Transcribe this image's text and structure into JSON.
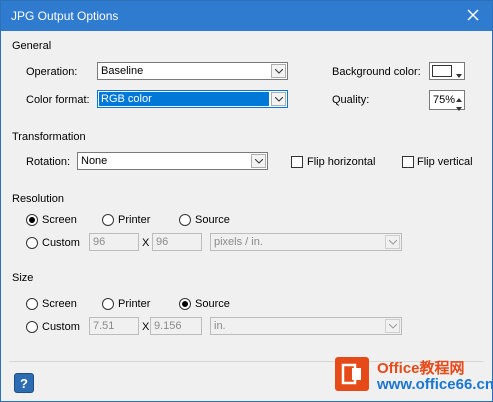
{
  "window": {
    "title": "JPG Output Options"
  },
  "general": {
    "section_label": "General",
    "operation_label": "Operation:",
    "operation_value": "Baseline",
    "color_format_label": "Color format:",
    "color_format_value": "RGB color",
    "background_color_label": "Background color:",
    "background_color_value": "#ffffff",
    "quality_label": "Quality:",
    "quality_value": "75%"
  },
  "transformation": {
    "section_label": "Transformation",
    "rotation_label": "Rotation:",
    "rotation_value": "None",
    "flip_horizontal_label": "Flip horizontal",
    "flip_vertical_label": "Flip vertical",
    "flip_horizontal_checked": false,
    "flip_vertical_checked": false
  },
  "resolution": {
    "section_label": "Resolution",
    "screen_label": "Screen",
    "printer_label": "Printer",
    "source_label": "Source",
    "custom_label": "Custom",
    "selected": "Screen",
    "custom_x": "96",
    "custom_x_sep": "X",
    "custom_y": "96",
    "unit_value": "pixels / in."
  },
  "size": {
    "section_label": "Size",
    "screen_label": "Screen",
    "printer_label": "Printer",
    "source_label": "Source",
    "custom_label": "Custom",
    "selected": "Source",
    "custom_x": "7.51",
    "custom_x_sep": "X",
    "custom_y": "9.156",
    "unit_value": "in."
  },
  "footer": {
    "help_glyph": "?",
    "brand_line1": "Office教程网",
    "brand_line2": "www.office66.cn"
  },
  "colors": {
    "titlebar": "#2f7bd0",
    "selection": "#0078d7",
    "brand_orange": "#e64a19",
    "brand_blue": "#1976d2"
  }
}
